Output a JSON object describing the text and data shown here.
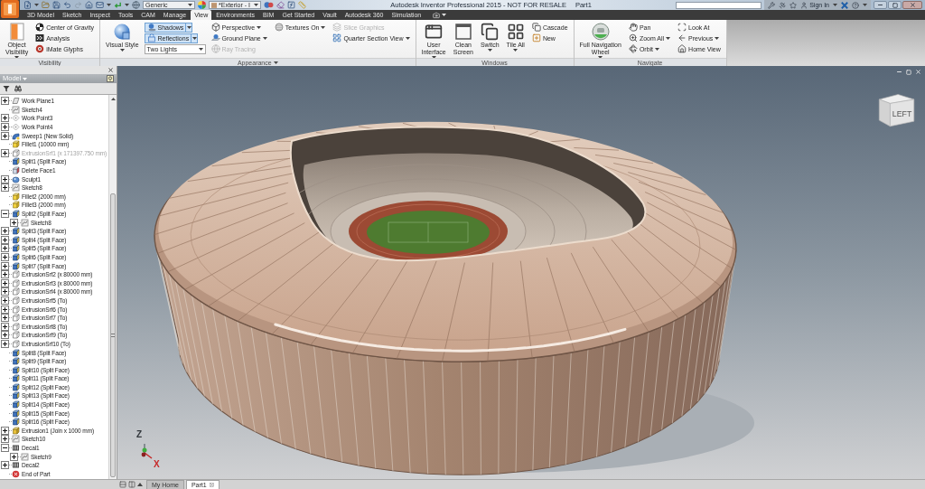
{
  "title_bar": {
    "material": "Generic",
    "appearance": "*Exterior - I",
    "title": "Autodesk Inventor Professional 2015 - NOT FOR RESALE",
    "document": "Part1",
    "sign_in": "Sign In"
  },
  "tabs": [
    {
      "label": "3D Model",
      "selected": false
    },
    {
      "label": "Sketch",
      "selected": false
    },
    {
      "label": "Inspect",
      "selected": false
    },
    {
      "label": "Tools",
      "selected": false
    },
    {
      "label": "CAM",
      "selected": false
    },
    {
      "label": "Manage",
      "selected": false
    },
    {
      "label": "View",
      "selected": true
    },
    {
      "label": "Environments",
      "selected": false
    },
    {
      "label": "BIM",
      "selected": false
    },
    {
      "label": "Get Started",
      "selected": false
    },
    {
      "label": "Vault",
      "selected": false
    },
    {
      "label": "Autodesk 360",
      "selected": false
    },
    {
      "label": "Simulation",
      "selected": false
    }
  ],
  "ribbon": {
    "panels": [
      {
        "title": "Visibility",
        "menu": false,
        "columns": [
          [
            {
              "kind": "large",
              "label": "Object\nVisibility",
              "menu": true,
              "disabled": false
            }
          ],
          [
            {
              "kind": "small",
              "label": "Center of Gravity",
              "menu": false,
              "disabled": false
            },
            {
              "kind": "small",
              "label": "Analysis",
              "menu": false,
              "disabled": false
            },
            {
              "kind": "small",
              "label": "iMate Glyphs",
              "menu": false,
              "disabled": false
            }
          ]
        ]
      },
      {
        "title": "Appearance",
        "menu": true,
        "columns": [
          [
            {
              "kind": "large",
              "label": "Visual Style",
              "menu": true,
              "disabled": false
            }
          ],
          [
            {
              "kind": "toggle",
              "label": "Shadows",
              "on": true,
              "menu": true,
              "disabled": false
            },
            {
              "kind": "toggle",
              "label": "Reflections",
              "on": true,
              "menu": true,
              "disabled": false
            },
            {
              "kind": "select",
              "value": "Two Lights",
              "menu": true,
              "disabled": false
            }
          ],
          [
            {
              "kind": "small",
              "label": "Perspective",
              "menu": true,
              "disabled": false
            },
            {
              "kind": "small",
              "label": "Ground Plane",
              "menu": true,
              "disabled": false
            },
            {
              "kind": "small",
              "label": "Ray Tracing",
              "menu": false,
              "disabled": true
            }
          ],
          [
            {
              "kind": "small",
              "label": "Textures On",
              "menu": true,
              "disabled": false
            }
          ],
          [
            {
              "kind": "small",
              "label": "Slice Graphics",
              "menu": false,
              "disabled": true
            },
            {
              "kind": "small",
              "label": "Quarter Section View",
              "menu": true,
              "disabled": false
            }
          ]
        ]
      },
      {
        "title": "Windows",
        "menu": false,
        "columns": [
          [
            {
              "kind": "large",
              "label": "User\nInterface",
              "menu": true,
              "disabled": false
            }
          ],
          [
            {
              "kind": "large",
              "label": "Clean\nScreen",
              "menu": false,
              "disabled": false
            }
          ],
          [
            {
              "kind": "large",
              "label": "Switch",
              "menu": true,
              "disabled": false
            }
          ],
          [
            {
              "kind": "large",
              "label": "Tile All",
              "menu": true,
              "disabled": false
            }
          ],
          [
            {
              "kind": "small",
              "label": "Cascade",
              "menu": false,
              "disabled": false
            },
            {
              "kind": "small",
              "label": "New",
              "menu": false,
              "disabled": false
            }
          ]
        ]
      },
      {
        "title": "Navigate",
        "menu": false,
        "columns": [
          [
            {
              "kind": "large",
              "label": "Full Navigation\nWheel",
              "menu": true,
              "disabled": false
            }
          ],
          [
            {
              "kind": "small",
              "label": "Pan",
              "menu": false,
              "disabled": false
            },
            {
              "kind": "small",
              "label": "Zoom All",
              "menu": true,
              "disabled": false
            },
            {
              "kind": "small",
              "label": "Orbit",
              "menu": true,
              "disabled": false
            }
          ],
          [
            {
              "kind": "small",
              "label": "Look At",
              "menu": false,
              "disabled": false
            },
            {
              "kind": "small",
              "label": "Previous",
              "menu": true,
              "disabled": false
            },
            {
              "kind": "small",
              "label": "Home View",
              "menu": false,
              "disabled": false
            }
          ]
        ]
      }
    ]
  },
  "browser": {
    "title": "Model",
    "nodes": [
      {
        "label": "Work Plane1",
        "kind": "work-plane",
        "disabled": false,
        "expanded": false
      },
      {
        "label": "Sketch4",
        "kind": "sketch",
        "disabled": false
      },
      {
        "label": "Work Point3",
        "kind": "work-point",
        "disabled": false,
        "expanded": false
      },
      {
        "label": "Work Point4",
        "kind": "work-point",
        "disabled": false,
        "expanded": false
      },
      {
        "label": "Sweep1 (New Solid)",
        "kind": "sweep",
        "disabled": false,
        "expanded": false
      },
      {
        "label": "Fillet1 (10000 mm)",
        "kind": "fillet",
        "disabled": false
      },
      {
        "label": "ExtrusionSrf1 (x 171397.750 mm)",
        "kind": "surface",
        "disabled": true,
        "expanded": false
      },
      {
        "label": "Split1 (Split Face)",
        "kind": "split",
        "disabled": false
      },
      {
        "label": "Delete Face1",
        "kind": "delete-face",
        "disabled": false
      },
      {
        "label": "Sculpt1",
        "kind": "sculpt",
        "disabled": false,
        "expanded": false
      },
      {
        "label": "Sketch8",
        "kind": "sketch",
        "disabled": false,
        "expanded": false
      },
      {
        "label": "Fillet2 (2000 mm)",
        "kind": "fillet",
        "disabled": false
      },
      {
        "label": "Fillet3 (2000 mm)",
        "kind": "fillet",
        "disabled": false
      },
      {
        "label": "Split2 (Split Face)",
        "kind": "split",
        "disabled": false,
        "expanded": true,
        "children": [
          {
            "label": "Sketch8",
            "kind": "sketch",
            "disabled": false,
            "expanded": false
          }
        ]
      },
      {
        "label": "Split3 (Split Face)",
        "kind": "split",
        "disabled": false,
        "expanded": false
      },
      {
        "label": "Split4 (Split Face)",
        "kind": "split",
        "disabled": false,
        "expanded": false
      },
      {
        "label": "Split5 (Split Face)",
        "kind": "split",
        "disabled": false,
        "expanded": false
      },
      {
        "label": "Split6 (Split Face)",
        "kind": "split",
        "disabled": false,
        "expanded": false
      },
      {
        "label": "Split7 (Split Face)",
        "kind": "split",
        "disabled": false,
        "expanded": false
      },
      {
        "label": "ExtrusionSrf2 (x 80000 mm)",
        "kind": "surface",
        "disabled": false,
        "expanded": false
      },
      {
        "label": "ExtrusionSrf3 (x 80000 mm)",
        "kind": "surface",
        "disabled": false,
        "expanded": false
      },
      {
        "label": "ExtrusionSrf4 (x 80000 mm)",
        "kind": "surface",
        "disabled": false,
        "expanded": false
      },
      {
        "label": "ExtrusionSrf5 (To)",
        "kind": "surface",
        "disabled": false,
        "expanded": false
      },
      {
        "label": "ExtrusionSrf6 (To)",
        "kind": "surface",
        "disabled": false,
        "expanded": false
      },
      {
        "label": "ExtrusionSrf7 (To)",
        "kind": "surface",
        "disabled": false,
        "expanded": false
      },
      {
        "label": "ExtrusionSrf8 (To)",
        "kind": "surface",
        "disabled": false,
        "expanded": false
      },
      {
        "label": "ExtrusionSrf9 (To)",
        "kind": "surface",
        "disabled": false,
        "expanded": false
      },
      {
        "label": "ExtrusionSrf10 (To)",
        "kind": "surface",
        "disabled": false,
        "expanded": false
      },
      {
        "label": "Split8 (Split Face)",
        "kind": "split",
        "disabled": false
      },
      {
        "label": "Split9 (Split Face)",
        "kind": "split",
        "disabled": false
      },
      {
        "label": "Split10 (Split Face)",
        "kind": "split",
        "disabled": false
      },
      {
        "label": "Split11 (Split Face)",
        "kind": "split",
        "disabled": false
      },
      {
        "label": "Split12 (Split Face)",
        "kind": "split",
        "disabled": false
      },
      {
        "label": "Split13 (Split Face)",
        "kind": "split",
        "disabled": false
      },
      {
        "label": "Split14 (Split Face)",
        "kind": "split",
        "disabled": false
      },
      {
        "label": "Split15 (Split Face)",
        "kind": "split",
        "disabled": false
      },
      {
        "label": "Split16 (Split Face)",
        "kind": "split",
        "disabled": false
      },
      {
        "label": "Extrusion1 (Join x 1000 mm)",
        "kind": "extrusion",
        "disabled": false,
        "expanded": false
      },
      {
        "label": "Sketch10",
        "kind": "sketch",
        "disabled": false,
        "expanded": false
      },
      {
        "label": "Decal1",
        "kind": "decal",
        "disabled": false,
        "expanded": true,
        "children": [
          {
            "label": "Sketch9",
            "kind": "sketch",
            "disabled": false,
            "expanded": false
          }
        ]
      },
      {
        "label": "Decal2",
        "kind": "decal",
        "disabled": false,
        "expanded": false
      },
      {
        "label": "End of Part",
        "kind": "end",
        "disabled": false
      }
    ]
  },
  "viewport": {
    "view_cube": "LEFT",
    "axis_labels": [
      {
        "label": "Z",
        "color": "#33383d"
      },
      {
        "label": "X",
        "color": "#c62828"
      }
    ]
  },
  "document_tabs": [
    {
      "label": "My Home",
      "selected": false
    },
    {
      "label": "Part1",
      "selected": true
    }
  ]
}
